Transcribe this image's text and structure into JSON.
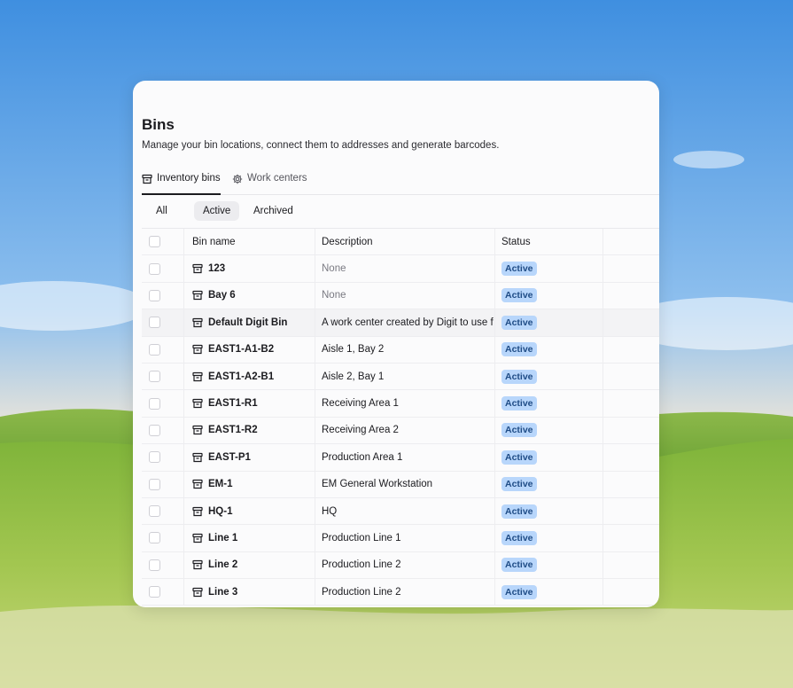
{
  "colors": {
    "badge_bg": "#b8d6fb",
    "badge_text": "#1f4c86",
    "accent": "#1b1b1f"
  },
  "page": {
    "title": "Bins",
    "subtitle": "Manage your bin locations, connect them to addresses and generate barcodes."
  },
  "tabs": [
    {
      "label": "Inventory bins",
      "icon": "archive-box-icon",
      "active": true
    },
    {
      "label": "Work centers",
      "icon": "gear-icon",
      "active": false
    }
  ],
  "filters": [
    {
      "label": "All",
      "selected": false
    },
    {
      "label": "Active",
      "selected": true
    },
    {
      "label": "Archived",
      "selected": false
    }
  ],
  "table": {
    "columns": [
      "Bin name",
      "Description",
      "Status"
    ],
    "rows": [
      {
        "name": "123",
        "description": "None",
        "status": "Active"
      },
      {
        "name": "Bay 6",
        "description": "None",
        "status": "Active"
      },
      {
        "name": "Default Digit Bin",
        "description": "A work center created by Digit to use f",
        "status": "Active"
      },
      {
        "name": "EAST1-A1-B2",
        "description": "Aisle 1, Bay 2",
        "status": "Active"
      },
      {
        "name": "EAST1-A2-B1",
        "description": "Aisle 2, Bay 1",
        "status": "Active"
      },
      {
        "name": "EAST1-R1",
        "description": "Receiving Area 1",
        "status": "Active"
      },
      {
        "name": "EAST1-R2",
        "description": "Receiving Area 2",
        "status": "Active"
      },
      {
        "name": "EAST-P1",
        "description": "Production Area 1",
        "status": "Active"
      },
      {
        "name": "EM-1",
        "description": "EM General Workstation",
        "status": "Active"
      },
      {
        "name": "HQ-1",
        "description": "HQ",
        "status": "Active"
      },
      {
        "name": "Line 1",
        "description": "Production Line 1",
        "status": "Active"
      },
      {
        "name": "Line 2",
        "description": "Production Line 2",
        "status": "Active"
      },
      {
        "name": "Line 3",
        "description": "Production Line 2",
        "status": "Active"
      }
    ]
  }
}
